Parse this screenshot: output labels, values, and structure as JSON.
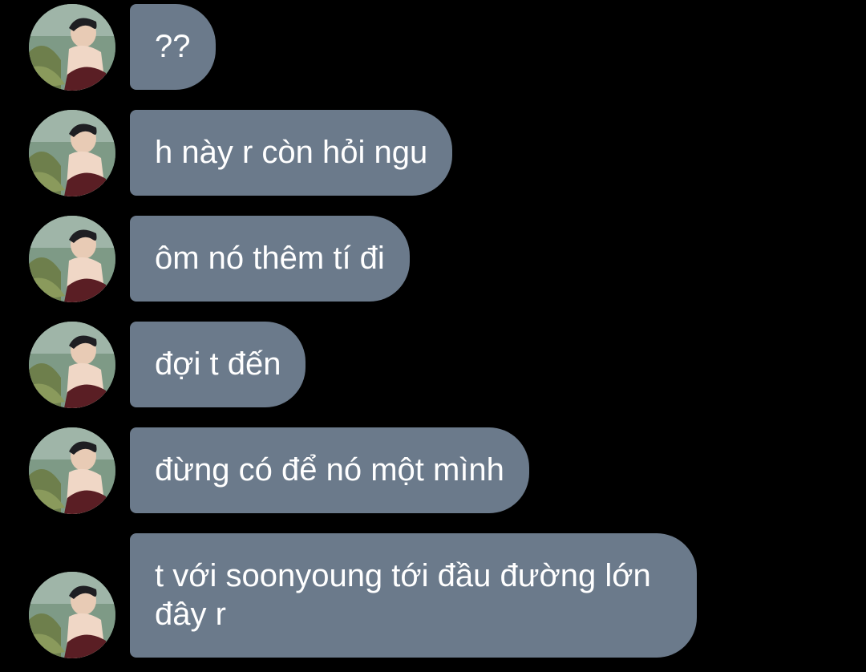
{
  "chat": {
    "messages": [
      {
        "text": "??"
      },
      {
        "text": "h này r còn hỏi ngu"
      },
      {
        "text": "ôm nó thêm tí đi"
      },
      {
        "text": "đợi t đến"
      },
      {
        "text": "đừng có để nó một mình"
      },
      {
        "text": "t với soonyoung tới đầu đường lớn\nđây r"
      }
    ],
    "avatar_icon": "user-photo-avatar",
    "bubble_color": "#6b7a8b",
    "background_color": "#000000"
  }
}
